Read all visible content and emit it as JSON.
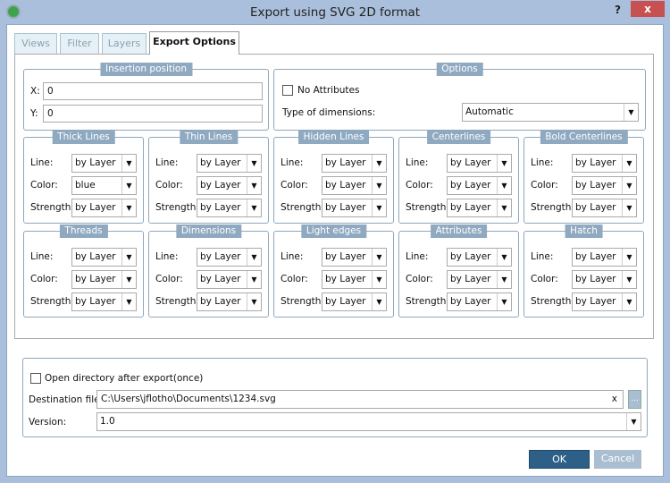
{
  "window": {
    "title": "Export using SVG 2D format",
    "help_label": "?",
    "close_label": "x"
  },
  "tabs": [
    {
      "label": "Views"
    },
    {
      "label": "Filter"
    },
    {
      "label": "Layers"
    },
    {
      "label": "Export Options",
      "active": true
    }
  ],
  "insertion": {
    "title": "Insertion position",
    "x_label": "X:",
    "x_value": "0",
    "y_label": "Y:",
    "y_value": "0"
  },
  "options": {
    "title": "Options",
    "no_attributes_label": "No Attributes",
    "no_attributes_checked": false,
    "dimensions_label": "Type of dimensions:",
    "dimensions_value": "Automatic"
  },
  "field_labels": {
    "line": "Line:",
    "color": "Color:",
    "strength": "Strength:"
  },
  "groups": [
    {
      "title": "Thick Lines",
      "line": "by Layer",
      "color": "blue",
      "strength": "by Layer"
    },
    {
      "title": "Thin Lines",
      "line": "by Layer",
      "color": "by Layer",
      "strength": "by Layer"
    },
    {
      "title": "Hidden Lines",
      "line": "by Layer",
      "color": "by Layer",
      "strength": "by Layer"
    },
    {
      "title": "Centerlines",
      "line": "by Layer",
      "color": "by Layer",
      "strength": "by Layer"
    },
    {
      "title": "Bold Centerlines",
      "line": "by Layer",
      "color": "by Layer",
      "strength": "by Layer"
    },
    {
      "title": "Threads",
      "line": "by Layer",
      "color": "by Layer",
      "strength": "by Layer"
    },
    {
      "title": "Dimensions",
      "line": "by Layer",
      "color": "by Layer",
      "strength": "by Layer"
    },
    {
      "title": "Light edges",
      "line": "by Layer",
      "color": "by Layer",
      "strength": "by Layer"
    },
    {
      "title": "Attributes",
      "line": "by Layer",
      "color": "by Layer",
      "strength": "by Layer"
    },
    {
      "title": "Hatch",
      "line": "by Layer",
      "color": "by Layer",
      "strength": "by Layer"
    }
  ],
  "output": {
    "open_dir_label": "Open directory after export(once)",
    "open_dir_checked": false,
    "dest_label": "Destination file:",
    "dest_value": "C:\\Users\\jflotho\\Documents\\1234.svg",
    "clear_label": "x",
    "browse_label": "...",
    "version_label": "Version:",
    "version_value": "1.0"
  },
  "buttons": {
    "ok": "OK",
    "cancel": "Cancel"
  },
  "colors": {
    "titlebar": "#a9bfdb",
    "close": "#c75050",
    "legend": "#8fa9c1",
    "ok": "#2e5f86",
    "cancel": "#a9bfd1"
  }
}
